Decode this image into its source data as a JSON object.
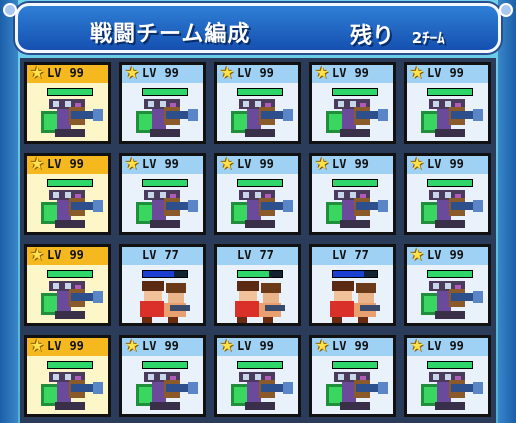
{
  "title": {
    "main": "戦闘チーム編成",
    "remain_label": "残り",
    "remain_count": "2",
    "remain_unit": "ﾁｰﾑ"
  },
  "colors": {
    "gold_header": "#f5b81e",
    "blue_header": "#9fd1f5",
    "hp_green": "#2fd76a",
    "hp_blue": "#1b3fd1"
  },
  "cards": [
    {
      "style": "gold",
      "star": true,
      "lv_label": "LV",
      "lv": "99",
      "bar": "green",
      "bar_fill": 1.0,
      "unit": "armored-team"
    },
    {
      "style": "blue",
      "star": true,
      "lv_label": "LV",
      "lv": "99",
      "bar": "green",
      "bar_fill": 1.0,
      "unit": "armored-team"
    },
    {
      "style": "blue",
      "star": true,
      "lv_label": "LV",
      "lv": "99",
      "bar": "green",
      "bar_fill": 1.0,
      "unit": "armored-team"
    },
    {
      "style": "blue",
      "star": true,
      "lv_label": "LV",
      "lv": "99",
      "bar": "green",
      "bar_fill": 1.0,
      "unit": "armored-team"
    },
    {
      "style": "blue",
      "star": true,
      "lv_label": "LV",
      "lv": "99",
      "bar": "green",
      "bar_fill": 1.0,
      "unit": "armored-team"
    },
    {
      "style": "gold",
      "star": true,
      "lv_label": "LV",
      "lv": "99",
      "bar": "green",
      "bar_fill": 1.0,
      "unit": "armored-team"
    },
    {
      "style": "blue",
      "star": true,
      "lv_label": "LV",
      "lv": "99",
      "bar": "green",
      "bar_fill": 1.0,
      "unit": "armored-team"
    },
    {
      "style": "blue",
      "star": true,
      "lv_label": "LV",
      "lv": "99",
      "bar": "green",
      "bar_fill": 1.0,
      "unit": "armored-team"
    },
    {
      "style": "blue",
      "star": true,
      "lv_label": "LV",
      "lv": "99",
      "bar": "green",
      "bar_fill": 1.0,
      "unit": "armored-team"
    },
    {
      "style": "blue",
      "star": true,
      "lv_label": "LV",
      "lv": "99",
      "bar": "green",
      "bar_fill": 1.0,
      "unit": "armored-team"
    },
    {
      "style": "gold",
      "star": true,
      "lv_label": "LV",
      "lv": "99",
      "bar": "green",
      "bar_fill": 1.0,
      "unit": "armored-team"
    },
    {
      "style": "bar-blue",
      "star": false,
      "lv_label": "LV",
      "lv": "77",
      "bar": "blue",
      "bar_fill": 0.7,
      "unit": "hero-team"
    },
    {
      "style": "bar-blue",
      "star": false,
      "lv_label": "LV",
      "lv": "77",
      "bar": "green",
      "bar_fill": 0.7,
      "unit": "hero-team"
    },
    {
      "style": "bar-blue",
      "star": false,
      "lv_label": "LV",
      "lv": "77",
      "bar": "blue",
      "bar_fill": 0.7,
      "unit": "hero-team"
    },
    {
      "style": "blue",
      "star": true,
      "lv_label": "LV",
      "lv": "99",
      "bar": "green",
      "bar_fill": 1.0,
      "unit": "armored-team"
    },
    {
      "style": "gold",
      "star": true,
      "lv_label": "LV",
      "lv": "99",
      "bar": "green",
      "bar_fill": 1.0,
      "unit": "armored-team"
    },
    {
      "style": "blue",
      "star": true,
      "lv_label": "LV",
      "lv": "99",
      "bar": "green",
      "bar_fill": 1.0,
      "unit": "armored-team"
    },
    {
      "style": "blue",
      "star": true,
      "lv_label": "LV",
      "lv": "99",
      "bar": "green",
      "bar_fill": 1.0,
      "unit": "armored-team"
    },
    {
      "style": "blue",
      "star": true,
      "lv_label": "LV",
      "lv": "99",
      "bar": "green",
      "bar_fill": 1.0,
      "unit": "armored-team"
    },
    {
      "style": "blue",
      "star": true,
      "lv_label": "LV",
      "lv": "99",
      "bar": "green",
      "bar_fill": 1.0,
      "unit": "armored-team"
    }
  ]
}
